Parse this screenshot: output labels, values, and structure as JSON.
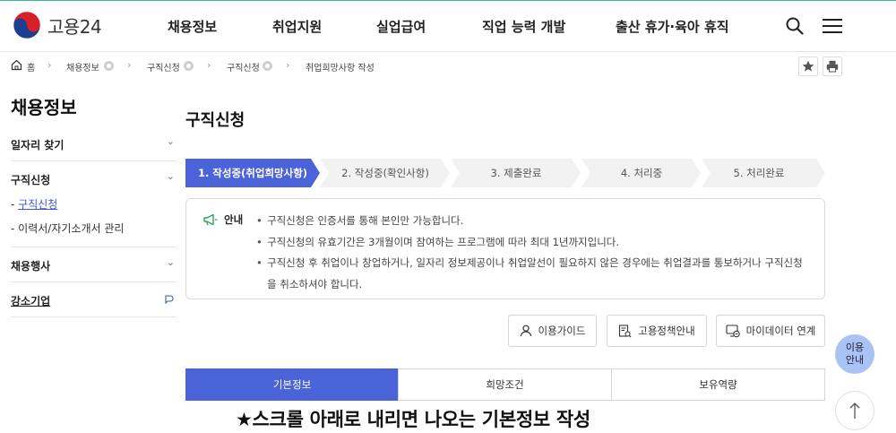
{
  "header": {
    "logo_text": "고용24",
    "nav": [
      "채용정보",
      "취업지원",
      "실업급여",
      "직업 능력 개발",
      "출산 휴가·육아 휴직"
    ]
  },
  "breadcrumb": {
    "home": "홈",
    "items": [
      "채용정보",
      "구직신청",
      "구직신청",
      "취업희망사항 작성"
    ]
  },
  "sidebar": {
    "title": "채용정보",
    "menus": [
      {
        "label": "일자리 찾기"
      },
      {
        "label": "구직신청",
        "subs": [
          "구직신청",
          "이력서/자기소개서 관리"
        ]
      },
      {
        "label": "채용행사"
      },
      {
        "label": "강소기업"
      }
    ],
    "sub_prefix": "- "
  },
  "main": {
    "title": "구직신청",
    "steps": [
      "1. 작성중(취업희망사항)",
      "2. 작성중(확인사항)",
      "3. 제출완료",
      "4. 처리중",
      "5. 처리완료"
    ],
    "active_step": 0,
    "guide": {
      "label": "안내",
      "items": [
        "구직신청은 인증서를 통해 본인만 가능합니다.",
        "구직신청의 유효기간은 3개월이며 참여하는 프로그램에 따라 최대 1년까지입니다.",
        "구직신청 후 취업이나 창업하거나, 일자리 정보제공이나 취업알선이 필요하지 않은 경우에는 취업결과를 통보하거나 구직신청을 취소하셔야 합니다."
      ]
    },
    "actions": [
      "이용가이드",
      "고용정책안내",
      "마이데이터 연계"
    ],
    "tabs": [
      "기본정보",
      "희망조건",
      "보유역량"
    ],
    "active_tab": 0
  },
  "annotation": "★스크롤 아래로 내리면 나오는 기본정보 작성",
  "floating": {
    "guide_line1": "이용",
    "guide_line2": "안내"
  },
  "colors": {
    "accent": "#4a63d8",
    "step_active": "#4a63d8",
    "step_inactive": "#f2f2f2",
    "float_guide": "#a9c3f5",
    "guide_icon": "#2fa55b"
  },
  "icons": {
    "logo": "korean-government-taegeuk-icon",
    "search": "search-icon",
    "menu": "hamburger-menu-icon",
    "home": "home-icon",
    "bookmark": "star-icon",
    "print": "print-icon",
    "guide": "megaphone-icon",
    "top": "arrow-up-icon"
  }
}
